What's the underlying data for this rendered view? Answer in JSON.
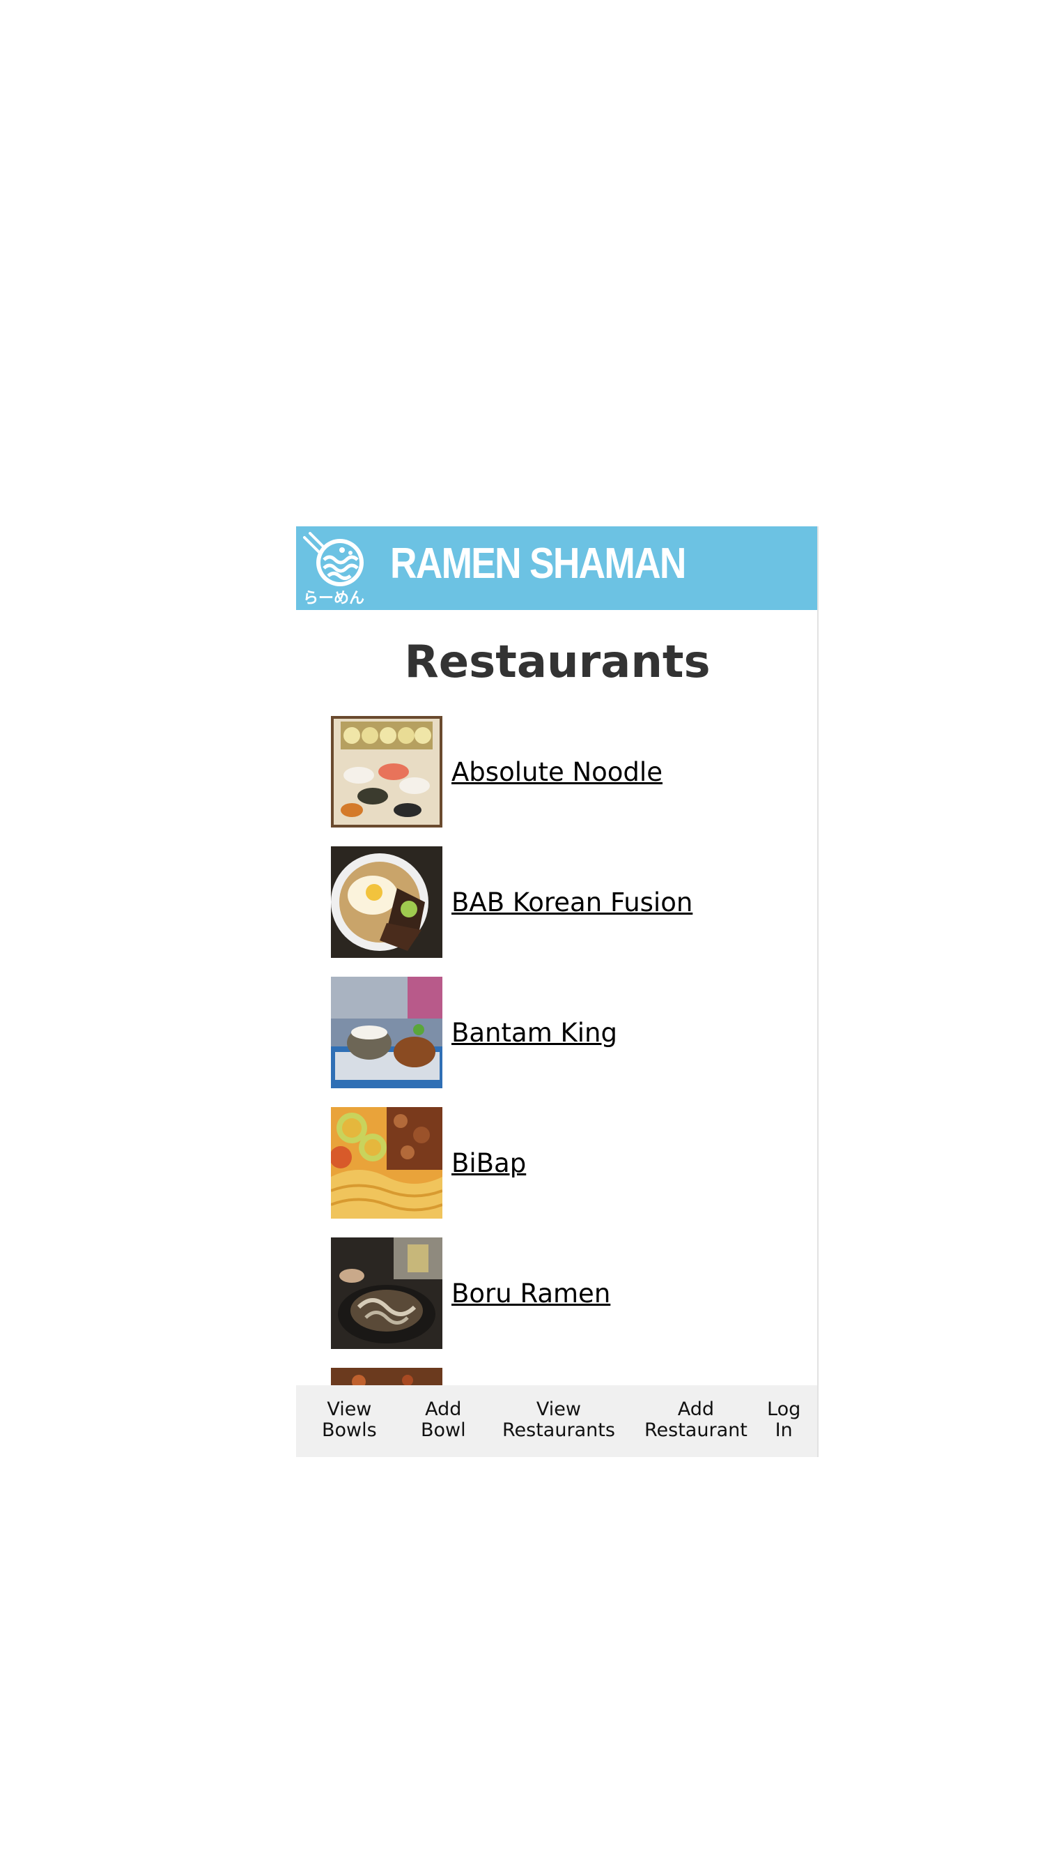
{
  "header": {
    "brand": "RAMEN SHAMAN",
    "logo_caption": "らーめん",
    "background_color": "#6cc2e3"
  },
  "page": {
    "title": "Restaurants"
  },
  "restaurants": [
    {
      "name": "Absolute Noodle"
    },
    {
      "name": "BAB Korean Fusion"
    },
    {
      "name": "Bantam King"
    },
    {
      "name": "BiBap"
    },
    {
      "name": "Boru Ramen"
    }
  ],
  "nav": [
    {
      "line1": "View",
      "line2": "Bowls"
    },
    {
      "line1": "Add",
      "line2": "Bowl"
    },
    {
      "line1": "View",
      "line2": "Restaurants"
    },
    {
      "line1": "Add",
      "line2": "Restaurant"
    },
    {
      "line1": "Log",
      "line2": "In"
    }
  ]
}
